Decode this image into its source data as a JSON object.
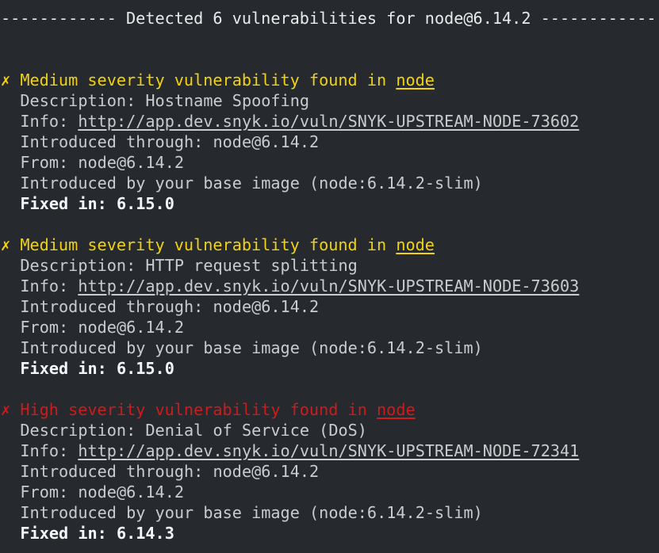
{
  "header": {
    "dashes_left": "------------",
    "title": "Detected 6 vulnerabilities for node@6.14.2",
    "dashes_right": "------------"
  },
  "colors": {
    "background": "#262a2e",
    "text": "#c9ccce",
    "medium": "#f2d20a",
    "high": "#cc1c1c",
    "fixed": "#f4f6f8"
  },
  "vulnerabilities": [
    {
      "severity": "medium",
      "marker": "✗",
      "heading": "Medium severity vulnerability found in",
      "package": "node",
      "description_label": "Description:",
      "description": "Hostname Spoofing",
      "info_label": "Info:",
      "info_url": "http://app.dev.snyk.io/vuln/SNYK-UPSTREAM-NODE-73602",
      "introduced_through_label": "Introduced through:",
      "introduced_through": "node@6.14.2",
      "from_label": "From:",
      "from": "node@6.14.2",
      "base_image_note": "Introduced by your base image (node:6.14.2-slim)",
      "fixed_in_label": "Fixed in:",
      "fixed_in": "6.15.0"
    },
    {
      "severity": "medium",
      "marker": "✗",
      "heading": "Medium severity vulnerability found in",
      "package": "node",
      "description_label": "Description:",
      "description": "HTTP request splitting",
      "info_label": "Info:",
      "info_url": "http://app.dev.snyk.io/vuln/SNYK-UPSTREAM-NODE-73603",
      "introduced_through_label": "Introduced through:",
      "introduced_through": "node@6.14.2",
      "from_label": "From:",
      "from": "node@6.14.2",
      "base_image_note": "Introduced by your base image (node:6.14.2-slim)",
      "fixed_in_label": "Fixed in:",
      "fixed_in": "6.15.0"
    },
    {
      "severity": "high",
      "marker": "✗",
      "heading": "High severity vulnerability found in",
      "package": "node",
      "description_label": "Description:",
      "description": "Denial of Service (DoS)",
      "info_label": "Info:",
      "info_url": "http://app.dev.snyk.io/vuln/SNYK-UPSTREAM-NODE-72341",
      "introduced_through_label": "Introduced through:",
      "introduced_through": "node@6.14.2",
      "from_label": "From:",
      "from": "node@6.14.2",
      "base_image_note": "Introduced by your base image (node:6.14.2-slim)",
      "fixed_in_label": "Fixed in:",
      "fixed_in": "6.14.3"
    }
  ]
}
